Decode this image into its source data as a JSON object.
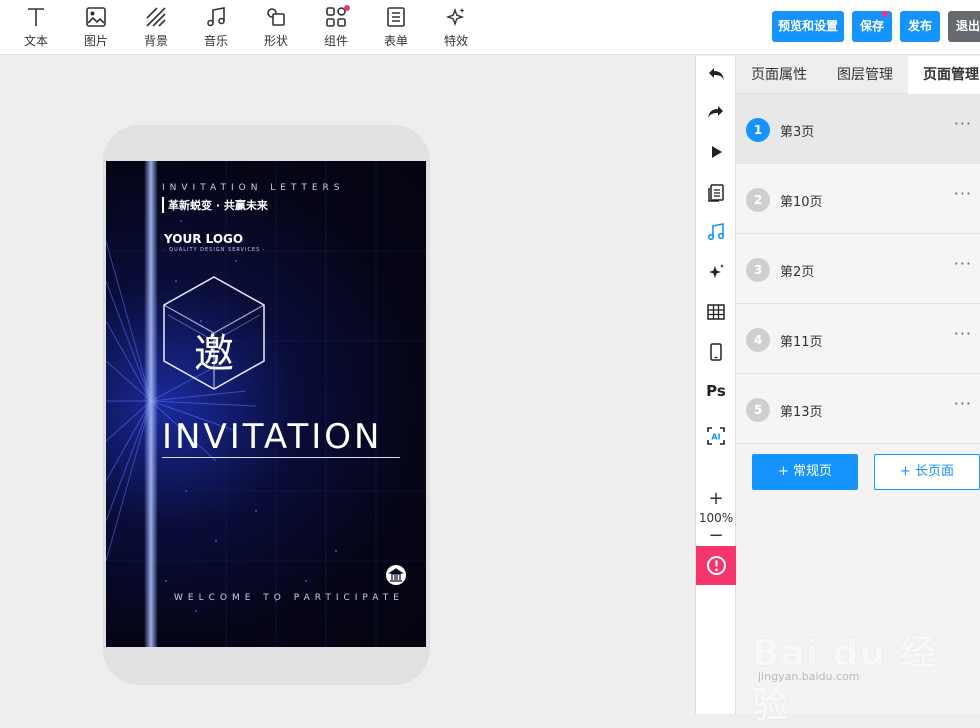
{
  "toolbar": {
    "tools": [
      {
        "label": "文本",
        "icon": "text-icon"
      },
      {
        "label": "图片",
        "icon": "image-icon"
      },
      {
        "label": "背景",
        "icon": "background-icon"
      },
      {
        "label": "音乐",
        "icon": "music-icon"
      },
      {
        "label": "形状",
        "icon": "shape-icon"
      },
      {
        "label": "组件",
        "icon": "component-icon"
      },
      {
        "label": "表单",
        "icon": "form-icon"
      },
      {
        "label": "特效",
        "icon": "effects-icon"
      }
    ],
    "preview_label": "预览和设置",
    "save_label": "保存",
    "publish_label": "发布",
    "exit_label": "退出"
  },
  "canvas": {
    "invite_letters": "INVITATION LETTERS",
    "slogan": "革新蜕变 · 共赢未来",
    "logo": "YOUR LOGO",
    "logo_sub": "· QUALITY DESIGN SERVICES ·",
    "cube_char": "邀",
    "headline": "INVITATION",
    "welcome": "WELCOME TO PARTICIPATE"
  },
  "side_tools": {
    "items": [
      "undo-icon",
      "redo-icon",
      "play-icon",
      "pages-icon",
      "music-icon",
      "magic-icon",
      "grid-icon",
      "phone-icon",
      "ps-icon",
      "ai-icon"
    ],
    "ps_label": "Ps",
    "ai_label": "AI",
    "zoom_in": "+",
    "zoom_level": "100%",
    "zoom_out": "−"
  },
  "panel": {
    "tabs": [
      "页面属性",
      "图层管理",
      "页面管理"
    ],
    "active_tab": "页面管理",
    "pages": [
      {
        "num": "1",
        "name": "第3页"
      },
      {
        "num": "2",
        "name": "第10页"
      },
      {
        "num": "3",
        "name": "第2页"
      },
      {
        "num": "4",
        "name": "第11页"
      },
      {
        "num": "5",
        "name": "第13页"
      }
    ],
    "more": "···",
    "add_normal": "+ 常规页",
    "add_long": "+ 长页面"
  },
  "watermark": {
    "brand": "Bai du 经验",
    "url": "jingyan.baidu.com"
  },
  "colors": {
    "accent": "#1593ff",
    "alert": "#f5356c",
    "exit": "#666a6e"
  }
}
